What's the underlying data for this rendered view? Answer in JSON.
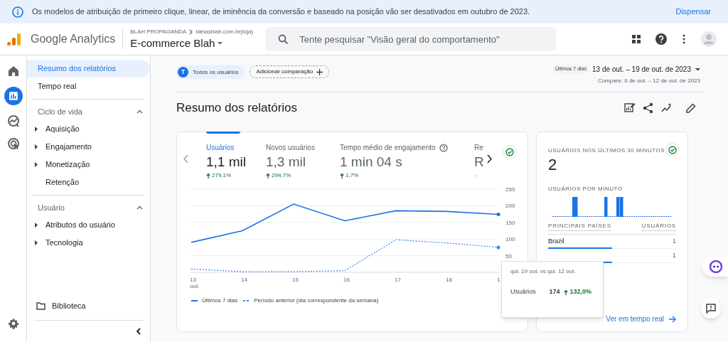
{
  "banner": {
    "message": "Os modelos de atribuição de primeiro clique, linear, de iminência da conversão e baseado na posição vão ser desativados em outubro de 2023.",
    "action": "Dispensar"
  },
  "header": {
    "product": "Google Analytics",
    "account": "BLAH PROPAGANDA",
    "property_path": "Ideiasblah.com.br(loja)",
    "property": "E-commerce Blah",
    "search": {
      "placeholder": "Tente pesquisar \"Visão geral do comportamento\""
    }
  },
  "rail": [
    {
      "kind": "home",
      "selected": false
    },
    {
      "kind": "reports",
      "selected": true
    },
    {
      "kind": "explore",
      "selected": false
    },
    {
      "kind": "advertising",
      "selected": false
    }
  ],
  "sidebar": {
    "items": [
      {
        "label": "Resumo dos relatórios",
        "selected": true
      },
      {
        "label": "Tempo real",
        "selected": false
      }
    ],
    "sections": [
      {
        "title": "Ciclo de vida",
        "expanded": true,
        "items": [
          {
            "label": "Aquisição",
            "kind": "group"
          },
          {
            "label": "Engajamento",
            "kind": "group"
          },
          {
            "label": "Monetização",
            "kind": "group"
          },
          {
            "label": "Retenção",
            "kind": "link"
          }
        ]
      },
      {
        "title": "Usuário",
        "expanded": true,
        "items": [
          {
            "label": "Atributos do usuário",
            "kind": "group"
          },
          {
            "label": "Tecnologia",
            "kind": "group"
          }
        ]
      }
    ],
    "library": "Biblioteca"
  },
  "toolbar": {
    "segment_initial": "T",
    "segment": "Todos os usuários",
    "add_comparison": "Adicionar comparação",
    "date_chip": "Últimos 7 dias",
    "date_range": "13 de out. – 19 de out. de 2023",
    "compare": "Compare: 6 de out. – 12 de out. de 2023"
  },
  "title": "Resumo dos relatórios",
  "metrics": [
    {
      "label": "Usuários",
      "value": "1,1 mil",
      "change": "279,1%",
      "selected": true,
      "help": false
    },
    {
      "label": "Novos usuários",
      "value": "1,3 mil",
      "change": "294,7%",
      "selected": false,
      "help": false
    },
    {
      "label": "Tempo médio de engajamento",
      "value": "1 min 04 s",
      "change": "1,7%",
      "selected": false,
      "help": true
    },
    {
      "label": "Re",
      "value": "R",
      "change": "-",
      "selected": false,
      "help": false
    }
  ],
  "chart_data": {
    "type": "line",
    "categories": [
      "13 out.",
      "14",
      "15",
      "16",
      "17",
      "18",
      "1"
    ],
    "yticks": [
      50,
      100,
      150,
      200,
      250
    ],
    "ylim": [
      0,
      250
    ],
    "grid": true,
    "legend": true,
    "series": [
      {
        "name": "Últimos 7 dias",
        "color": "#1a73e8",
        "line_style": "solid",
        "values": [
          90,
          125,
          205,
          155,
          185,
          183,
          174
        ]
      },
      {
        "name": "Período anterior (dia correspondente da semana)",
        "color": "#4285f4",
        "line_style": "dashed",
        "values": [
          10,
          2,
          2,
          5,
          98,
          88,
          75
        ]
      }
    ]
  },
  "tooltip": {
    "title": "qui. 19 out. vs qui. 12 out.",
    "metric": "Usuários",
    "value": "174",
    "change": "132,0%"
  },
  "realtime": {
    "title": "USUÁRIOS NOS ÚLTIMOS 30 MINUTOS",
    "value": "2",
    "per_minute": "USUÁRIOS POR MINUTO",
    "columns": [
      "PRINCIPAIS PAÍSES",
      "USUÁRIOS"
    ],
    "rows": [
      {
        "country": "Brazil",
        "users": "1",
        "level": 0.5
      },
      {
        "users": "1",
        "level": 0.5
      }
    ],
    "link": "Ver em tempo real"
  }
}
